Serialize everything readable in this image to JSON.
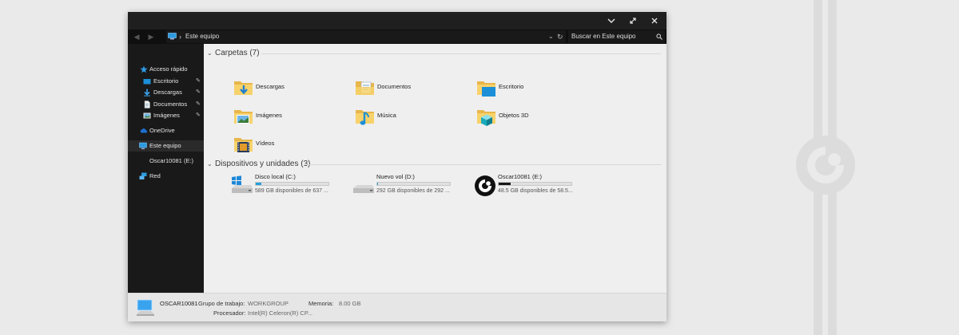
{
  "window": {
    "controls": {
      "collapse_icon": "chevron-down-icon",
      "restore_icon": "restore-icon",
      "close_icon": "close-icon"
    }
  },
  "address": {
    "location": "Este equipo",
    "search_placeholder": "Buscar en Este equipo"
  },
  "sidebar": {
    "items": [
      {
        "label": "Acceso rápido",
        "icon": "star-icon",
        "pinned": false
      },
      {
        "label": "Escritorio",
        "icon": "desktop-icon",
        "pinned": true
      },
      {
        "label": "Descargas",
        "icon": "download-icon",
        "pinned": true
      },
      {
        "label": "Documentos",
        "icon": "document-icon",
        "pinned": true
      },
      {
        "label": "Imágenes",
        "icon": "image-icon",
        "pinned": true
      },
      {
        "label": "OneDrive",
        "icon": "cloud-icon",
        "pinned": false
      },
      {
        "label": "Este equipo",
        "icon": "computer-icon",
        "pinned": false,
        "selected": true
      },
      {
        "label": "Oscar10081 (E:)",
        "icon": "",
        "pinned": false
      },
      {
        "label": "Red",
        "icon": "network-icon",
        "pinned": false
      }
    ]
  },
  "folders_group": {
    "title": "Carpetas (7)",
    "items": [
      {
        "label": "Descargas",
        "icon": "download-folder-icon"
      },
      {
        "label": "Documentos",
        "icon": "documents-folder-icon"
      },
      {
        "label": "Escritorio",
        "icon": "desktop-folder-icon"
      },
      {
        "label": "Imágenes",
        "icon": "pictures-folder-icon"
      },
      {
        "label": "Música",
        "icon": "music-folder-icon"
      },
      {
        "label": "Objetos 3D",
        "icon": "3d-objects-folder-icon"
      },
      {
        "label": "Vídeos",
        "icon": "videos-folder-icon"
      }
    ]
  },
  "drives_group": {
    "title": "Dispositivos y unidades (3)",
    "items": [
      {
        "label": "Disco local (C:)",
        "free": "589 GB disponibles de 637 ...",
        "used_fraction": 0.08,
        "icon": "windows-drive-icon"
      },
      {
        "label": "Nuevo vol (D:)",
        "free": "292 GB disponibles de 292 ...",
        "used_fraction": 0.01,
        "icon": "drive-icon"
      },
      {
        "label": "Oscar10081 (E:)",
        "free": "48.5 GB disponibles de 58.5...",
        "used_fraction": 0.17,
        "icon": "custom-drive-logo-icon"
      }
    ]
  },
  "details": {
    "computer_name": "OSCAR10081",
    "workgroup_label": "Grupo de trabajo:",
    "workgroup_value": "WORKGROUP",
    "memory_label": "Memoria:",
    "memory_value": "8.00 GB",
    "processor_label": "Procesador:",
    "processor_value": "Intel(R) Celeron(R) CP..."
  },
  "colors": {
    "accent": "#26a0da",
    "folder": "#f5c452",
    "dark_bg": "#1a1a1a",
    "content_bg": "#efefef"
  }
}
